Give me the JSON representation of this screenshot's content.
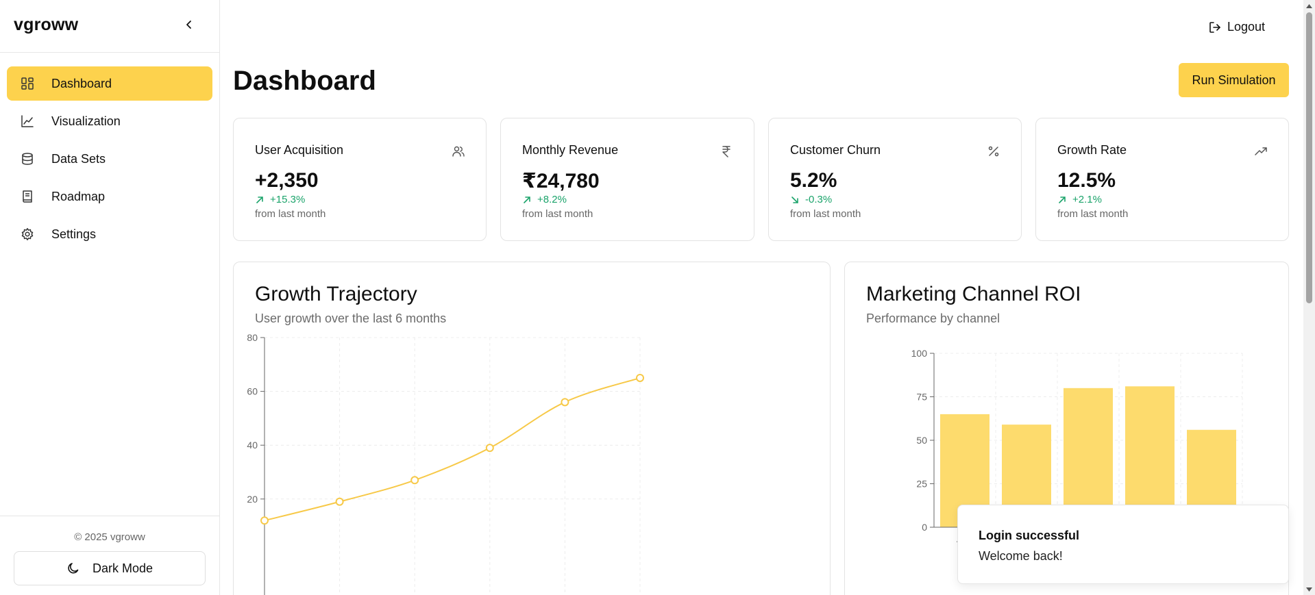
{
  "app": {
    "brand": "vgroww"
  },
  "sidebar": {
    "items": [
      {
        "label": "Dashboard",
        "icon": "dashboard-icon",
        "active": true
      },
      {
        "label": "Visualization",
        "icon": "line-chart-icon"
      },
      {
        "label": "Data Sets",
        "icon": "database-icon"
      },
      {
        "label": "Roadmap",
        "icon": "book-icon"
      },
      {
        "label": "Settings",
        "icon": "gear-icon"
      }
    ],
    "copyright": "© 2025 vgroww",
    "dark_mode_label": "Dark Mode"
  },
  "header": {
    "logout_label": "Logout"
  },
  "page": {
    "title": "Dashboard",
    "run_label": "Run Simulation"
  },
  "stats": [
    {
      "title": "User Acquisition",
      "value": "+2,350",
      "change": "+15.3%",
      "direction": "up",
      "note": "from last month",
      "icon": "users-icon"
    },
    {
      "title": "Monthly Revenue",
      "value": "₹24,780",
      "change": "+8.2%",
      "direction": "up",
      "note": "from last month",
      "icon": "rupee-icon"
    },
    {
      "title": "Customer Churn",
      "value": "5.2%",
      "change": "-0.3%",
      "direction": "down",
      "note": "from last month",
      "icon": "percent-icon"
    },
    {
      "title": "Growth Rate",
      "value": "12.5%",
      "change": "+2.1%",
      "direction": "up",
      "note": "from last month",
      "icon": "trending-up-icon"
    }
  ],
  "growth": {
    "title": "Growth Trajectory",
    "subtitle": "User growth over the last 6 months"
  },
  "roi": {
    "title": "Marketing Channel ROI",
    "subtitle": "Performance by channel",
    "first_tick_label": "Adv"
  },
  "toast": {
    "title": "Login successful",
    "description": "Welcome back!"
  },
  "colors": {
    "accent": "#fdd24d",
    "line": "#f7c948",
    "bar": "#fddb6d",
    "positive": "#1aa36a"
  },
  "chart_data": [
    {
      "type": "line",
      "title": "Growth Trajectory",
      "subtitle": "User growth over the last 6 months",
      "x": [
        1,
        2,
        3,
        4,
        5,
        6
      ],
      "values": [
        12,
        19,
        27,
        39,
        56,
        65
      ],
      "yticks": [
        20,
        40,
        60,
        80
      ],
      "ylim": [
        0,
        80
      ],
      "grid": true
    },
    {
      "type": "bar",
      "title": "Marketing Channel ROI",
      "subtitle": "Performance by channel",
      "categories": [
        "Adv",
        "",
        "",
        "",
        ""
      ],
      "values": [
        65,
        59,
        80,
        81,
        56
      ],
      "yticks": [
        0,
        25,
        50,
        75,
        100
      ],
      "ylim": [
        0,
        100
      ],
      "grid": true
    }
  ]
}
